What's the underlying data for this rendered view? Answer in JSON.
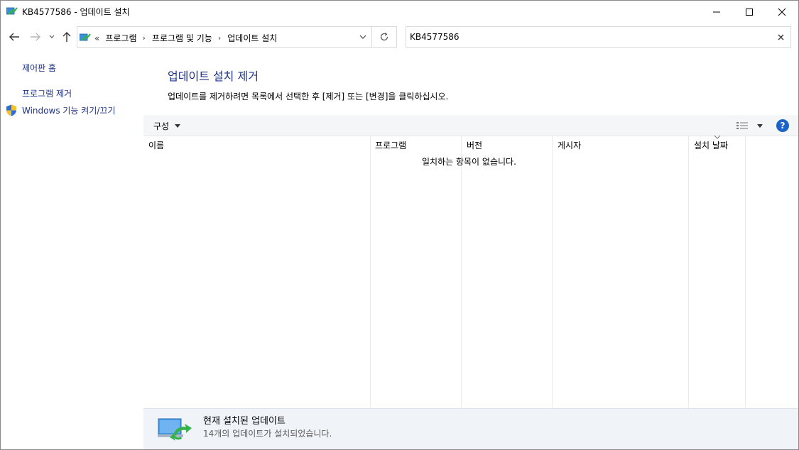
{
  "window": {
    "title": "KB4577586 - 업데이트 설치"
  },
  "address": {
    "overflow": "«",
    "crumbs": [
      "프로그램",
      "프로그램 및 기능",
      "업데이트 설치"
    ],
    "separator": "›"
  },
  "search": {
    "value": "KB4577586"
  },
  "left_pane": {
    "home": "제어판 홈",
    "uninstall": "프로그램 제거",
    "features": "Windows 기능 켜기/끄기"
  },
  "main": {
    "title": "업데이트 설치 제거",
    "description": "업데이트를 제거하려면 목록에서 선택한 후 [제거] 또는 [변경]을 클릭하십시오."
  },
  "toolbar": {
    "organize": "구성",
    "help": "?"
  },
  "list": {
    "columns": [
      "이름",
      "프로그램",
      "버전",
      "게시자",
      "설치 날짜"
    ],
    "empty_message": "일치하는 항목이 없습니다."
  },
  "details": {
    "title": "현재 설치된 업데이트",
    "subtitle": "14개의 업데이트가 설치되었습니다."
  },
  "colors": {
    "link": "#1e3287",
    "help_blue": "#1a63c8",
    "details_bg": "#f0f4f9"
  }
}
